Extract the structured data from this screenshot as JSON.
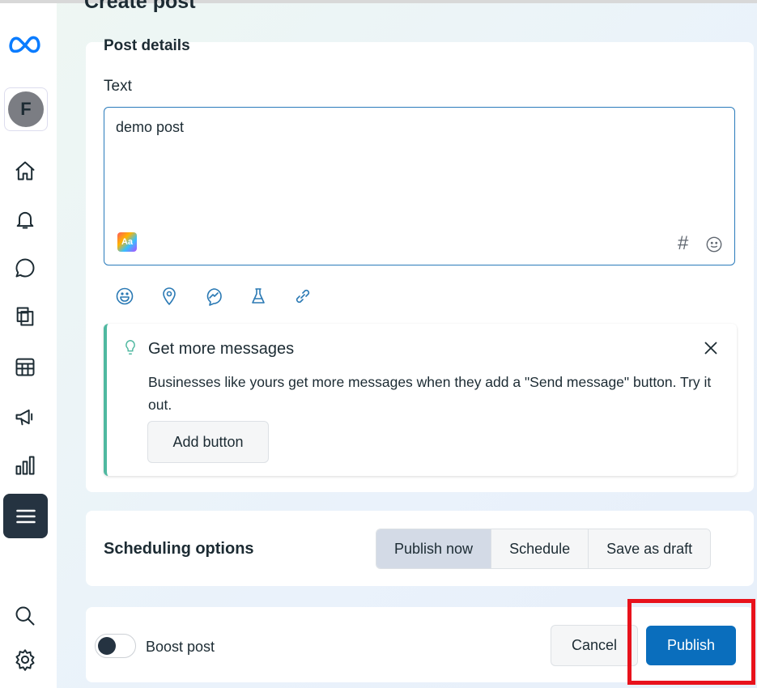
{
  "page": {
    "title": "Create post"
  },
  "sidebar": {
    "avatar_initial": "F",
    "items": [
      "home",
      "notifications",
      "messages",
      "pages",
      "planner",
      "ads",
      "insights",
      "menu"
    ],
    "bottom": [
      "search",
      "settings"
    ]
  },
  "post_details": {
    "heading": "Post details",
    "text_label": "Text",
    "text_value": "demo post",
    "format_badge": "Aa",
    "hashtag": "#"
  },
  "tip": {
    "title": "Get more messages",
    "body": "Businesses like yours get more messages when they add a \"Send message\" button. Try it out.",
    "button": "Add button"
  },
  "scheduling": {
    "heading": "Scheduling options",
    "options": [
      "Publish now",
      "Schedule",
      "Save as draft"
    ],
    "selected": "Publish now"
  },
  "footer": {
    "boost_label": "Boost post",
    "boost_on": false,
    "cancel": "Cancel",
    "publish": "Publish"
  },
  "colors": {
    "accent": "#0a6ebd",
    "highlight": "#e8121c",
    "tip_border": "#4fb8a0"
  }
}
